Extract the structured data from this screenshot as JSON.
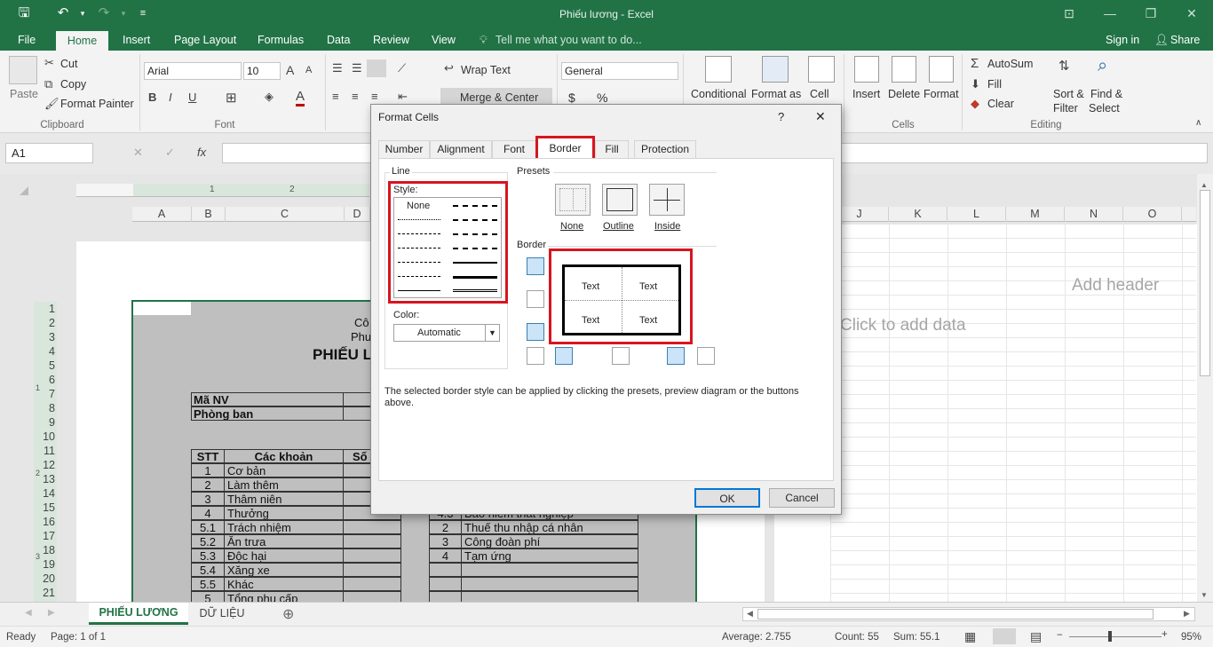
{
  "window": {
    "title": "Phiếu lương - Excel"
  },
  "ribbon_tabs": [
    "File",
    "Home",
    "Insert",
    "Page Layout",
    "Formulas",
    "Data",
    "Review",
    "View"
  ],
  "tell_me": "Tell me what you want to do...",
  "account": {
    "sign_in": "Sign in",
    "share": "Share"
  },
  "clipboard": {
    "paste": "Paste",
    "cut": "Cut",
    "copy": "Copy",
    "format_painter": "Format Painter",
    "label": "Clipboard"
  },
  "font_group": {
    "font": "Arial",
    "size": "10",
    "label": "Font",
    "bold": "B",
    "italic": "I",
    "underline": "U"
  },
  "alignment": {
    "wrap": "Wrap Text",
    "merge": "Merge & Center"
  },
  "number": {
    "format": "General",
    "currency": "$",
    "percent": "%"
  },
  "styles": {
    "conditional": "Conditional",
    "format_as": "Format as",
    "cell": "Cell"
  },
  "cells": {
    "insert": "Insert",
    "delete": "Delete",
    "format": "Format",
    "label": "Cells"
  },
  "editing": {
    "autosum": "AutoSum",
    "fill": "Fill",
    "clear": "Clear",
    "sort": "Sort &",
    "filter": "Filter",
    "find": "Find &",
    "select": "Select",
    "label": "Editing"
  },
  "formula_bar": {
    "name_box": "A1",
    "fx": "fx"
  },
  "ruler": {
    "one": "1",
    "two": "2"
  },
  "columns_left": [
    "A",
    "B",
    "C",
    "D"
  ],
  "columns_right": [
    "J",
    "K",
    "L",
    "M",
    "N",
    "O"
  ],
  "rows": [
    "1",
    "2",
    "3",
    "4",
    "5",
    "6",
    "7",
    "8",
    "9",
    "10",
    "11",
    "12",
    "13",
    "14",
    "15",
    "16",
    "17",
    "18",
    "19",
    "20",
    "21"
  ],
  "vruler_marks": [
    "1",
    "2",
    "3"
  ],
  "header_text": {
    "add_header": "Add header",
    "click_data": "Click to add data"
  },
  "sheet": {
    "r2": "Cô",
    "r3": "Phu",
    "title": "PHIẾU L",
    "ma_nv": "Mã NV",
    "phong_ban": "Phòng ban",
    "stt": "STT",
    "cac_khoan": "Các khoản",
    "so": "Số",
    "items": [
      [
        "1",
        "Cơ bản"
      ],
      [
        "2",
        "Làm thêm"
      ],
      [
        "3",
        "Thâm niên"
      ],
      [
        "4",
        "Thưởng"
      ],
      [
        "5.1",
        "Trách nhiệm"
      ],
      [
        "5.2",
        "Ăn trưa"
      ],
      [
        "5.3",
        "Độc hại"
      ],
      [
        "5.4",
        "Xăng xe"
      ],
      [
        "5.5",
        "Khác"
      ],
      [
        "5",
        "Tổng phụ cấp"
      ]
    ],
    "right_items": [
      [
        "4.3",
        "Bảo hiểm thất nghiệp"
      ],
      [
        "2",
        "Thuế thu nhập cá nhân"
      ],
      [
        "3",
        "Công đoàn phí"
      ],
      [
        "4",
        "Tạm ứng"
      ]
    ]
  },
  "sheet_tabs": [
    "PHIẾU LƯƠNG",
    "DỮ LIỆU"
  ],
  "status": {
    "ready": "Ready",
    "page": "Page: 1 of 1",
    "average": "Average: 2.755",
    "count": "Count: 55",
    "sum": "Sum: 55.1",
    "zoom": "95%"
  },
  "dialog": {
    "title": "Format Cells",
    "help": "?",
    "close": "✕",
    "tabs": [
      "Number",
      "Alignment",
      "Font",
      "Border",
      "Fill",
      "Protection"
    ],
    "line": "Line",
    "style": "Style:",
    "none_style": "None",
    "color": "Color:",
    "color_value": "Automatic",
    "presets": "Presets",
    "preset_none": "None",
    "preset_outline": "Outline",
    "preset_inside": "Inside",
    "border": "Border",
    "preview_text": [
      "Text",
      "Text",
      "Text",
      "Text"
    ],
    "hint": "The selected border style can be applied by clicking the presets, preview diagram or the buttons above.",
    "ok": "OK",
    "cancel": "Cancel"
  },
  "colors": {
    "excel_green": "#217346",
    "highlight_red": "#d7151f",
    "ok_blue": "#0078d7"
  }
}
